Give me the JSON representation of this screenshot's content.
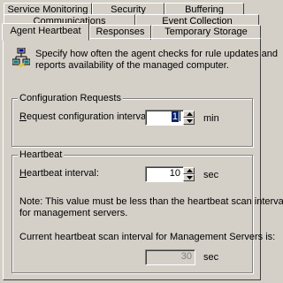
{
  "tabs": {
    "row1": [
      {
        "label": "Service Monitoring"
      },
      {
        "label": "Security"
      },
      {
        "label": "Buffering"
      }
    ],
    "row2": [
      {
        "label": "Communications"
      },
      {
        "label": "Event Collection"
      }
    ],
    "row3": [
      {
        "label": "Agent Heartbeat",
        "active": true
      },
      {
        "label": "Responses"
      },
      {
        "label": "Temporary Storage"
      }
    ]
  },
  "intro": {
    "icon": "heartbeat-network-icon",
    "text_line1": "Specify how often the agent checks for rule updates and",
    "text_line2": "reports availability of the managed computer."
  },
  "config_group": {
    "title": "Configuration Requests",
    "label_accel": "R",
    "label_rest": "equest configuration interval:",
    "value": "1",
    "unit": "min"
  },
  "heartbeat_group": {
    "title": "Heartbeat",
    "label_accel": "H",
    "label_rest": "eartbeat interval:",
    "value": "10",
    "unit": "sec",
    "note_line1": "Note: This value must be less than the heartbeat scan interval",
    "note_line2": "for management servers.",
    "current_label": "Current heartbeat scan interval for Management Servers is:",
    "current_value": "30",
    "current_unit": "sec"
  }
}
